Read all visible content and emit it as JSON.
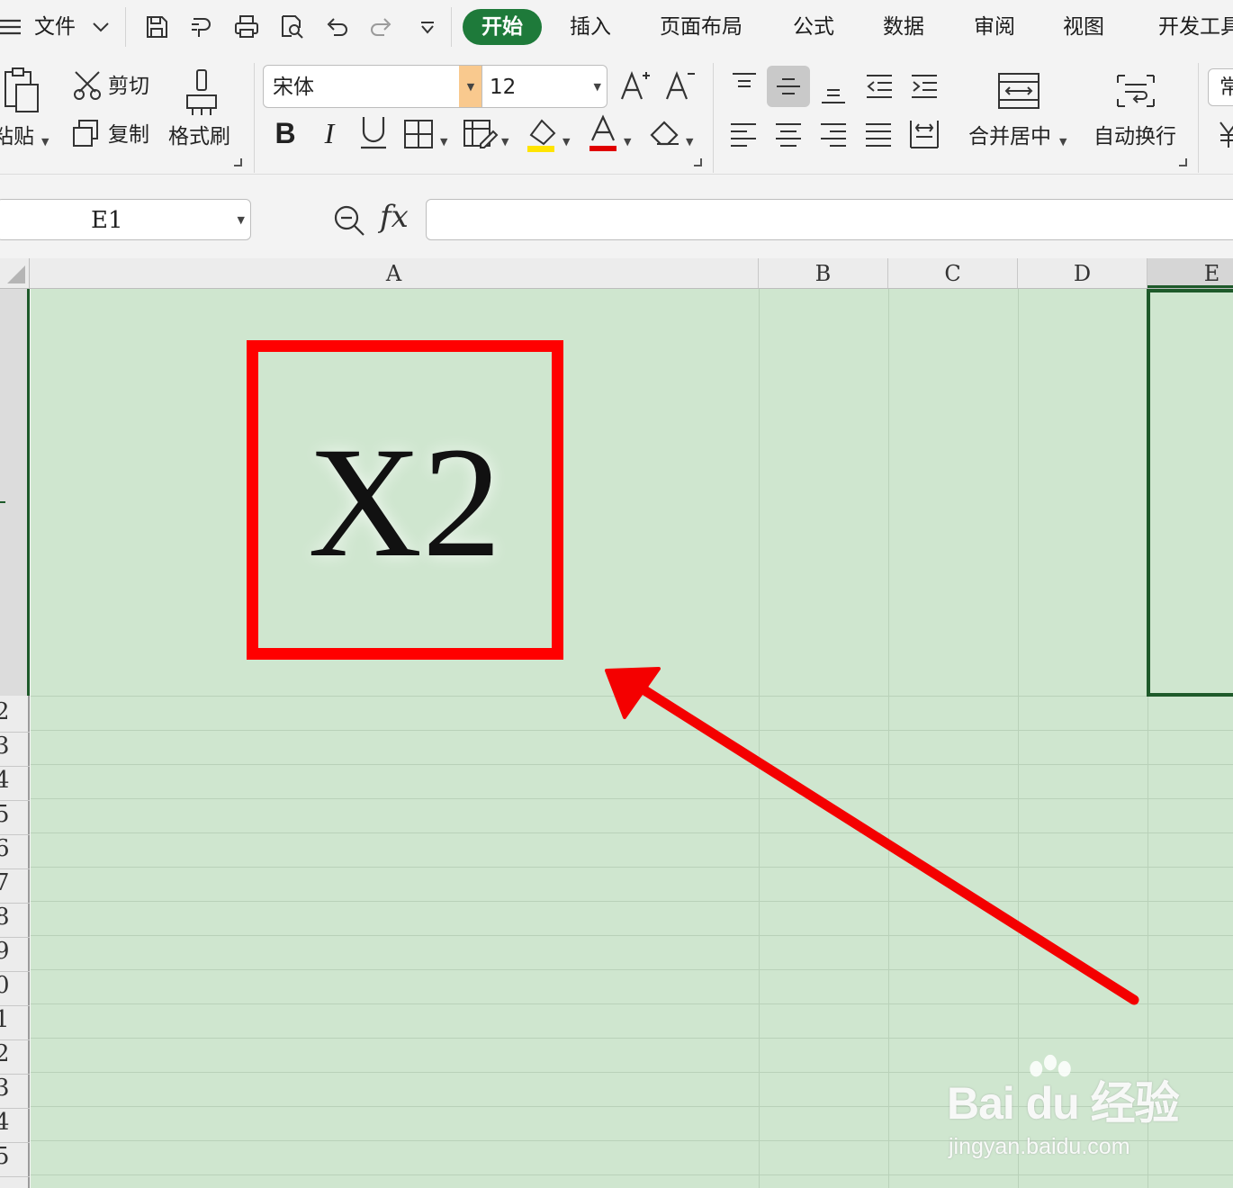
{
  "menubar": {
    "file_label": "文件",
    "tabs": [
      {
        "label": "开始",
        "active": true
      },
      {
        "label": "插入"
      },
      {
        "label": "页面布局"
      },
      {
        "label": "公式"
      },
      {
        "label": "数据"
      },
      {
        "label": "审阅"
      },
      {
        "label": "视图"
      },
      {
        "label": "开发工具"
      }
    ],
    "quick_icons": [
      "save-icon",
      "format-painter-icon",
      "print-icon",
      "print-preview-icon",
      "undo-icon",
      "redo-icon",
      "customize-icon"
    ],
    "accent_color": "#1e7a3a"
  },
  "ribbon": {
    "paste_label": "粘贴",
    "cut_label": "剪切",
    "copy_label": "复制",
    "format_painter_label": "格式刷",
    "font_name": "宋体",
    "font_size": "12",
    "bold_glyph": "B",
    "italic_glyph": "I",
    "underline_glyph": "U",
    "merge_center_label": "合并居中",
    "wrap_text_label": "自动换行",
    "partial_right_label": "常"
  },
  "formula_bar": {
    "cell_ref": "E1",
    "fx_label": "fx",
    "formula_value": ""
  },
  "sheet": {
    "columns": [
      "A",
      "B",
      "C",
      "D",
      "E"
    ],
    "selected_column": "E",
    "selected_cell": "E1",
    "row_labels": [
      "2",
      "3",
      "4",
      "5",
      "6",
      "7",
      "8",
      "9",
      "0",
      "1",
      "2",
      "3",
      "4",
      "5"
    ],
    "cell_a1": "X2",
    "grid_color": "#cfe6cf",
    "annotation_color": "#ff0000"
  },
  "watermark": {
    "brand": "Bai du 经验",
    "url": "jingyan.baidu.com"
  }
}
